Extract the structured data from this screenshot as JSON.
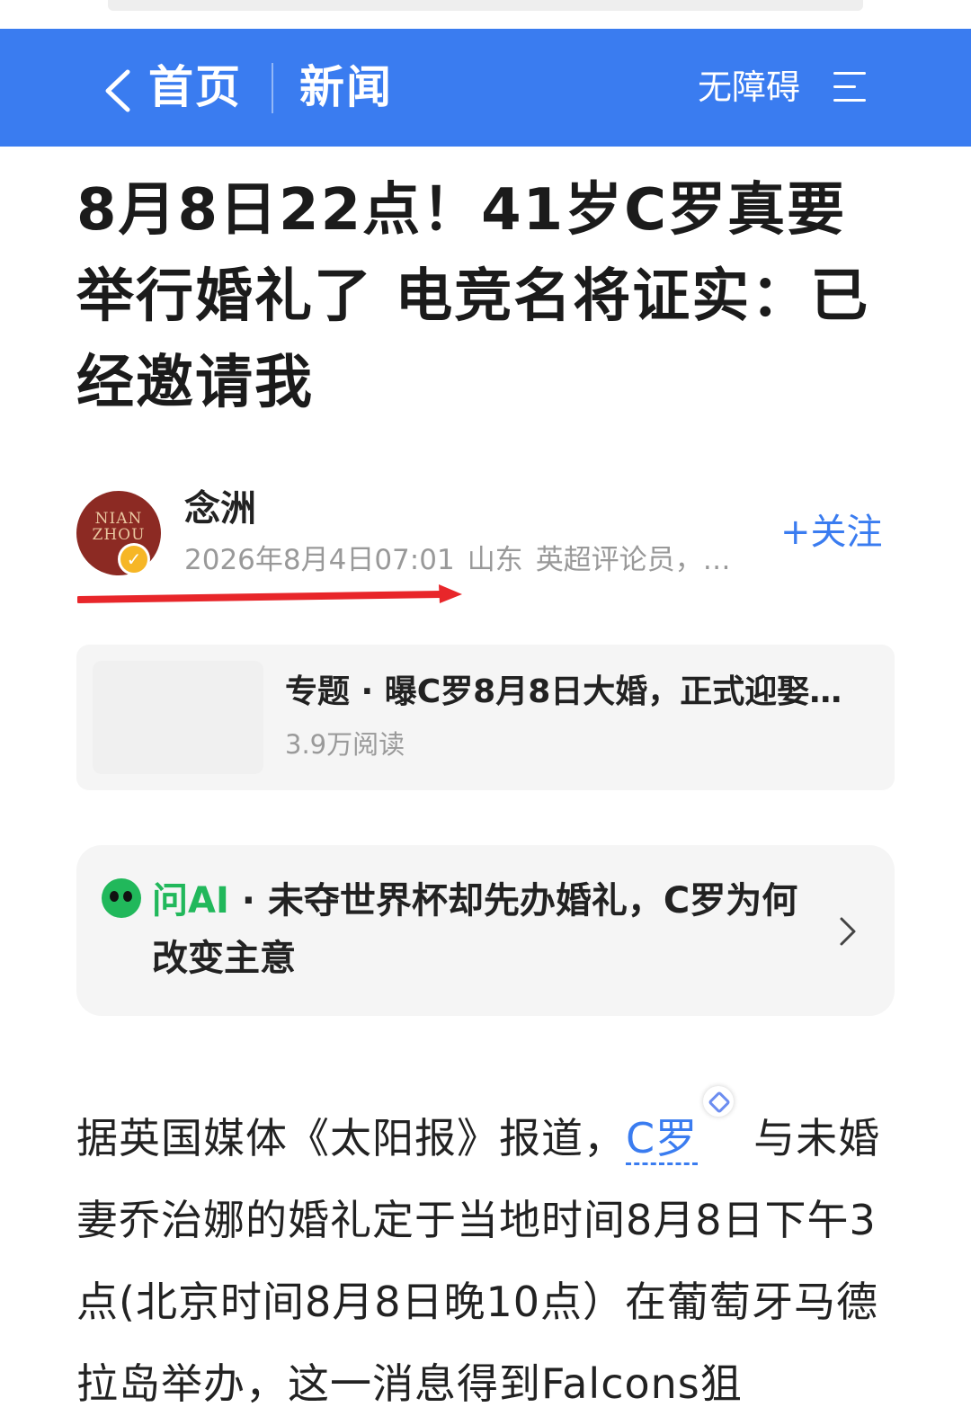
{
  "nav": {
    "back_label": "首页",
    "section_label": "新闻",
    "accessibility_label": "无障碍",
    "bg_color": "#3a7cf0"
  },
  "article": {
    "title": "8月8日22点！41岁C罗真要举行婚礼了 电竞名将证实：已经邀请我",
    "author": {
      "name": "念洲",
      "avatar_text": "NIAN ZHOU",
      "date": "2026年8月4日07:01",
      "location": "山东",
      "tagline": "英超评论员，…",
      "follow_label": "+关注"
    },
    "topic": {
      "title": "专题 · 曝C罗8月8日大婚，正式迎娶…",
      "reads": "3.9万阅读"
    },
    "ask_ai": {
      "prefix": "问AI",
      "text": " · 未夺世界杯却先办婚礼，C罗为何改变主意"
    },
    "body": {
      "part1": "据英国媒体《太阳报》报道，",
      "link": "C罗",
      "part2": "与未婚妻乔治娜的婚礼定于当地时间8月8日下午3点(北京时间8月8日晚10点）在葡萄牙马德拉岛举办，这一消息得到Falcons狙"
    }
  }
}
